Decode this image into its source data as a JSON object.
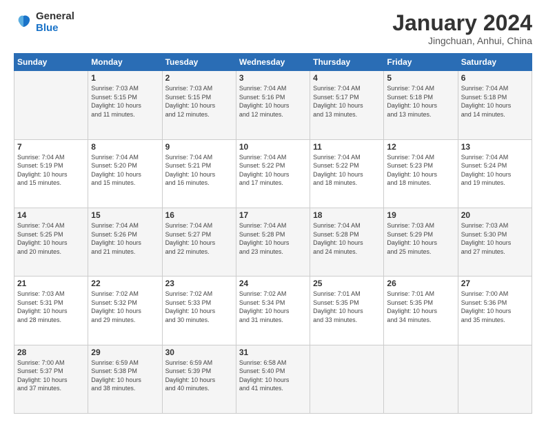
{
  "header": {
    "logo_line1": "General",
    "logo_line2": "Blue",
    "month_title": "January 2024",
    "subtitle": "Jingchuan, Anhui, China"
  },
  "weekdays": [
    "Sunday",
    "Monday",
    "Tuesday",
    "Wednesday",
    "Thursday",
    "Friday",
    "Saturday"
  ],
  "weeks": [
    [
      {
        "day": "",
        "info": ""
      },
      {
        "day": "1",
        "info": "Sunrise: 7:03 AM\nSunset: 5:15 PM\nDaylight: 10 hours\nand 11 minutes."
      },
      {
        "day": "2",
        "info": "Sunrise: 7:03 AM\nSunset: 5:15 PM\nDaylight: 10 hours\nand 12 minutes."
      },
      {
        "day": "3",
        "info": "Sunrise: 7:04 AM\nSunset: 5:16 PM\nDaylight: 10 hours\nand 12 minutes."
      },
      {
        "day": "4",
        "info": "Sunrise: 7:04 AM\nSunset: 5:17 PM\nDaylight: 10 hours\nand 13 minutes."
      },
      {
        "day": "5",
        "info": "Sunrise: 7:04 AM\nSunset: 5:18 PM\nDaylight: 10 hours\nand 13 minutes."
      },
      {
        "day": "6",
        "info": "Sunrise: 7:04 AM\nSunset: 5:18 PM\nDaylight: 10 hours\nand 14 minutes."
      }
    ],
    [
      {
        "day": "7",
        "info": "Sunrise: 7:04 AM\nSunset: 5:19 PM\nDaylight: 10 hours\nand 15 minutes."
      },
      {
        "day": "8",
        "info": "Sunrise: 7:04 AM\nSunset: 5:20 PM\nDaylight: 10 hours\nand 15 minutes."
      },
      {
        "day": "9",
        "info": "Sunrise: 7:04 AM\nSunset: 5:21 PM\nDaylight: 10 hours\nand 16 minutes."
      },
      {
        "day": "10",
        "info": "Sunrise: 7:04 AM\nSunset: 5:22 PM\nDaylight: 10 hours\nand 17 minutes."
      },
      {
        "day": "11",
        "info": "Sunrise: 7:04 AM\nSunset: 5:22 PM\nDaylight: 10 hours\nand 18 minutes."
      },
      {
        "day": "12",
        "info": "Sunrise: 7:04 AM\nSunset: 5:23 PM\nDaylight: 10 hours\nand 18 minutes."
      },
      {
        "day": "13",
        "info": "Sunrise: 7:04 AM\nSunset: 5:24 PM\nDaylight: 10 hours\nand 19 minutes."
      }
    ],
    [
      {
        "day": "14",
        "info": "Sunrise: 7:04 AM\nSunset: 5:25 PM\nDaylight: 10 hours\nand 20 minutes."
      },
      {
        "day": "15",
        "info": "Sunrise: 7:04 AM\nSunset: 5:26 PM\nDaylight: 10 hours\nand 21 minutes."
      },
      {
        "day": "16",
        "info": "Sunrise: 7:04 AM\nSunset: 5:27 PM\nDaylight: 10 hours\nand 22 minutes."
      },
      {
        "day": "17",
        "info": "Sunrise: 7:04 AM\nSunset: 5:28 PM\nDaylight: 10 hours\nand 23 minutes."
      },
      {
        "day": "18",
        "info": "Sunrise: 7:04 AM\nSunset: 5:28 PM\nDaylight: 10 hours\nand 24 minutes."
      },
      {
        "day": "19",
        "info": "Sunrise: 7:03 AM\nSunset: 5:29 PM\nDaylight: 10 hours\nand 25 minutes."
      },
      {
        "day": "20",
        "info": "Sunrise: 7:03 AM\nSunset: 5:30 PM\nDaylight: 10 hours\nand 27 minutes."
      }
    ],
    [
      {
        "day": "21",
        "info": "Sunrise: 7:03 AM\nSunset: 5:31 PM\nDaylight: 10 hours\nand 28 minutes."
      },
      {
        "day": "22",
        "info": "Sunrise: 7:02 AM\nSunset: 5:32 PM\nDaylight: 10 hours\nand 29 minutes."
      },
      {
        "day": "23",
        "info": "Sunrise: 7:02 AM\nSunset: 5:33 PM\nDaylight: 10 hours\nand 30 minutes."
      },
      {
        "day": "24",
        "info": "Sunrise: 7:02 AM\nSunset: 5:34 PM\nDaylight: 10 hours\nand 31 minutes."
      },
      {
        "day": "25",
        "info": "Sunrise: 7:01 AM\nSunset: 5:35 PM\nDaylight: 10 hours\nand 33 minutes."
      },
      {
        "day": "26",
        "info": "Sunrise: 7:01 AM\nSunset: 5:35 PM\nDaylight: 10 hours\nand 34 minutes."
      },
      {
        "day": "27",
        "info": "Sunrise: 7:00 AM\nSunset: 5:36 PM\nDaylight: 10 hours\nand 35 minutes."
      }
    ],
    [
      {
        "day": "28",
        "info": "Sunrise: 7:00 AM\nSunset: 5:37 PM\nDaylight: 10 hours\nand 37 minutes."
      },
      {
        "day": "29",
        "info": "Sunrise: 6:59 AM\nSunset: 5:38 PM\nDaylight: 10 hours\nand 38 minutes."
      },
      {
        "day": "30",
        "info": "Sunrise: 6:59 AM\nSunset: 5:39 PM\nDaylight: 10 hours\nand 40 minutes."
      },
      {
        "day": "31",
        "info": "Sunrise: 6:58 AM\nSunset: 5:40 PM\nDaylight: 10 hours\nand 41 minutes."
      },
      {
        "day": "",
        "info": ""
      },
      {
        "day": "",
        "info": ""
      },
      {
        "day": "",
        "info": ""
      }
    ]
  ]
}
